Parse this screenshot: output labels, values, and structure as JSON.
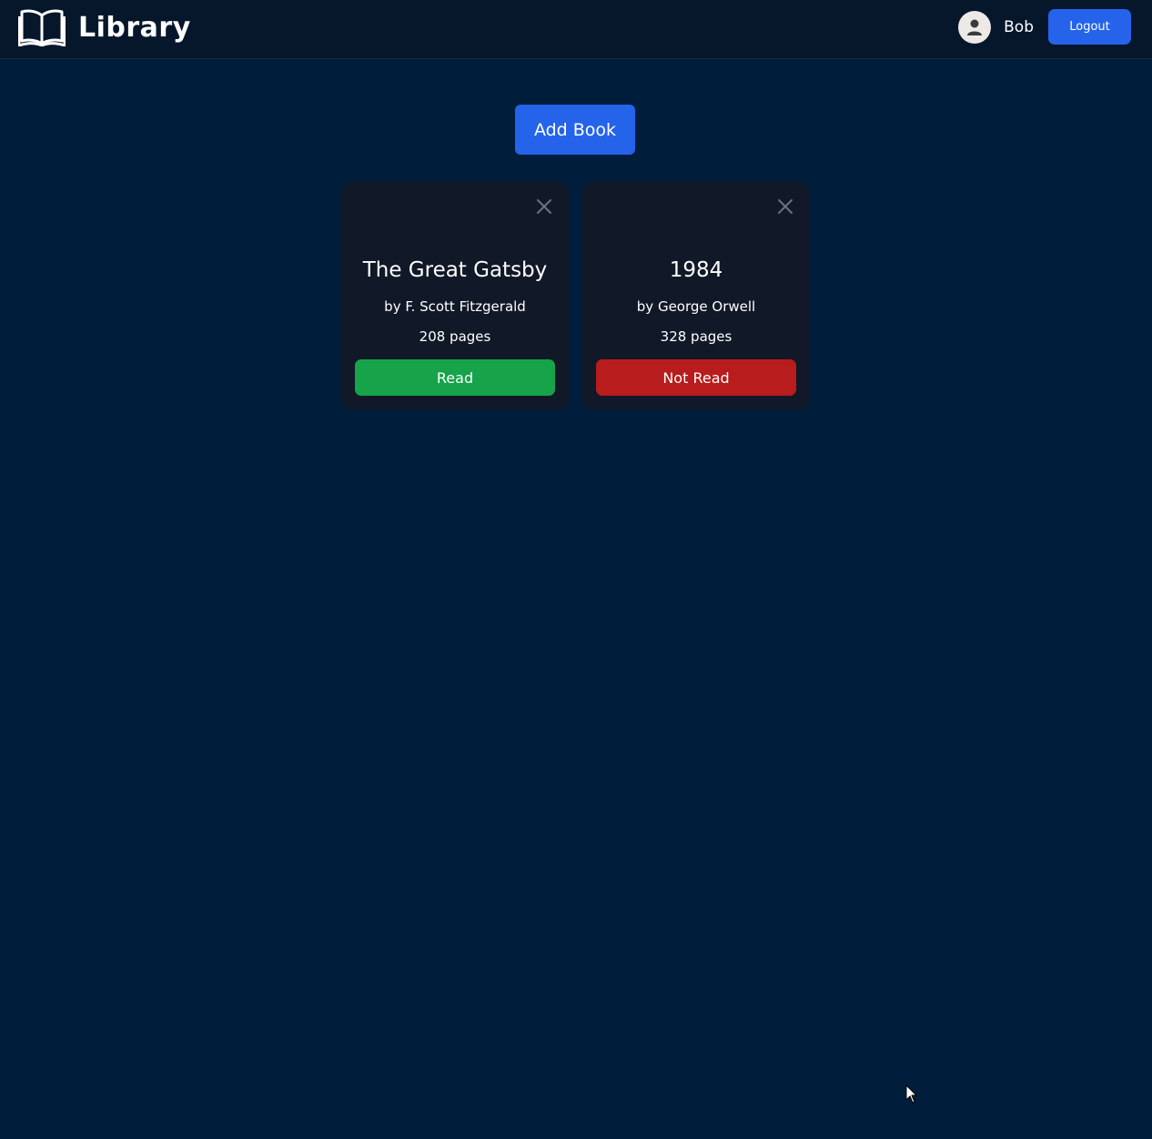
{
  "header": {
    "app_title": "Library",
    "logo_icon": "open-book-icon",
    "user": {
      "avatar_icon": "user-silhouette-icon",
      "name": "Bob"
    },
    "logout_label": "Logout"
  },
  "main": {
    "add_book_label": "Add Book"
  },
  "books": [
    {
      "title": "The Great Gatsby",
      "author": "by F. Scott Fitzgerald",
      "pages": "208 pages",
      "status_label": "Read",
      "status_color": "#16a34a"
    },
    {
      "title": "1984",
      "author": "by George Orwell",
      "pages": "328 pages",
      "status_label": "Not Read",
      "status_color": "#b91c1c"
    }
  ],
  "colors": {
    "background": "#001d3b",
    "header_background": "#06172b",
    "card_background": "#111827",
    "primary_button": "#2563eb"
  }
}
